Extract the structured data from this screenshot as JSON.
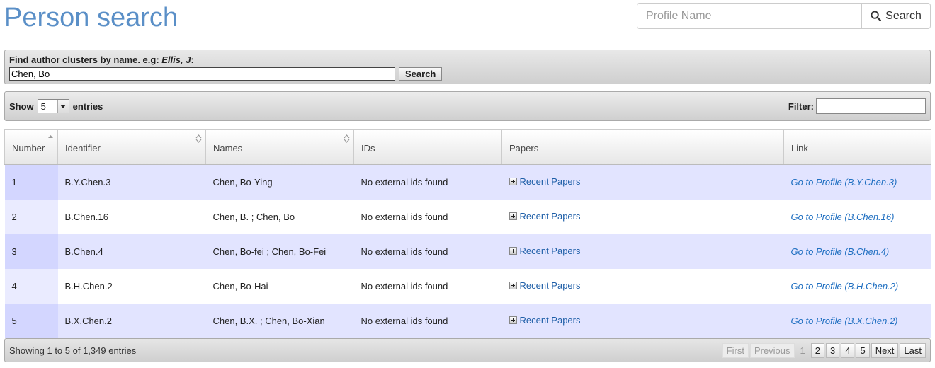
{
  "header": {
    "title": "Person search",
    "search_placeholder": "Profile Name",
    "search_button": "Search"
  },
  "find": {
    "label_prefix": "Find author clusters by name. e.g: ",
    "label_example": "Ellis, J",
    "label_suffix": ":",
    "query_value": "Chen, Bo",
    "search_button": "Search"
  },
  "controls": {
    "show_label": "Show",
    "entries_value": "5",
    "entries_label": "entries",
    "filter_label": "Filter:"
  },
  "table": {
    "columns": [
      "Number",
      "Identifier",
      "Names",
      "IDs",
      "Papers",
      "Link"
    ],
    "rows": [
      {
        "number": "1",
        "identifier": "B.Y.Chen.3",
        "names": "Chen, Bo-Ying",
        "ids": "No external ids found",
        "papers": "Recent Papers",
        "link": "Go to Profile (B.Y.Chen.3)"
      },
      {
        "number": "2",
        "identifier": "B.Chen.16",
        "names": "Chen, B. ;  Chen, Bo",
        "ids": "No external ids found",
        "papers": "Recent Papers",
        "link": "Go to Profile (B.Chen.16)"
      },
      {
        "number": "3",
        "identifier": "B.Chen.4",
        "names": "Chen, Bo-fei ;  Chen, Bo-Fei",
        "ids": "No external ids found",
        "papers": "Recent Papers",
        "link": "Go to Profile (B.Chen.4)"
      },
      {
        "number": "4",
        "identifier": "B.H.Chen.2",
        "names": "Chen, Bo-Hai",
        "ids": "No external ids found",
        "papers": "Recent Papers",
        "link": "Go to Profile (B.H.Chen.2)"
      },
      {
        "number": "5",
        "identifier": "B.X.Chen.2",
        "names": "Chen, B.X. ;  Chen, Bo-Xian",
        "ids": "No external ids found",
        "papers": "Recent Papers",
        "link": "Go to Profile (B.X.Chen.2)"
      }
    ]
  },
  "footer": {
    "info": "Showing 1 to 5 of 1,349 entries",
    "first": "First",
    "previous": "Previous",
    "pages": [
      "1",
      "2",
      "3",
      "4",
      "5"
    ],
    "next": "Next",
    "last": "Last"
  },
  "icons": {
    "search": "search-icon",
    "sort": "sort-icon",
    "expand": "plus-icon"
  },
  "colors": {
    "title": "#5a8fc7",
    "row_odd": "#e2e4ff",
    "row_odd_sorted": "#d3d6ff",
    "link": "#1f6fc1"
  }
}
